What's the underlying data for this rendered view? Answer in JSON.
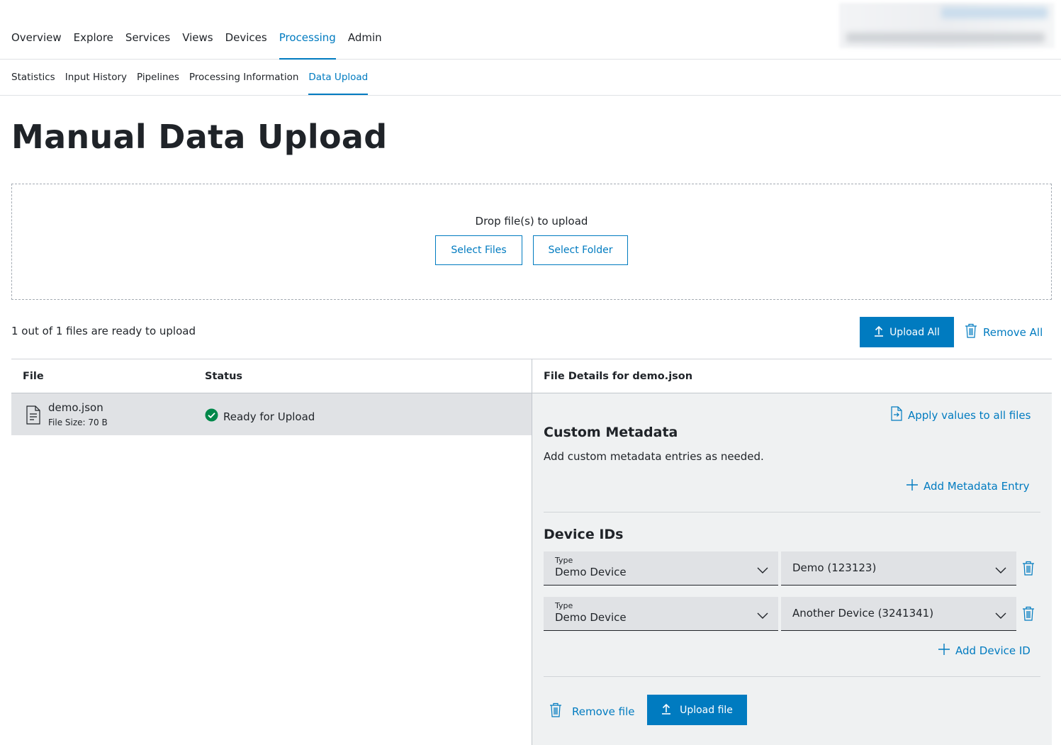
{
  "topnav": {
    "tabs": [
      "Overview",
      "Explore",
      "Services",
      "Views",
      "Devices",
      "Processing",
      "Admin"
    ],
    "active": "Processing"
  },
  "subnav": {
    "tabs": [
      "Statistics",
      "Input History",
      "Pipelines",
      "Processing Information",
      "Data Upload"
    ],
    "active": "Data Upload"
  },
  "page_title": "Manual Data Upload",
  "dropzone": {
    "text": "Drop file(s) to upload",
    "select_files": "Select Files",
    "select_folder": "Select Folder"
  },
  "summary": {
    "ready_text": "1 out of 1 files are ready to upload",
    "upload_all": "Upload All",
    "remove_all": "Remove All"
  },
  "table": {
    "col_file": "File",
    "col_status": "Status",
    "rows": [
      {
        "name": "demo.json",
        "size": "File Size: 70 B",
        "status": "Ready for Upload"
      }
    ]
  },
  "details": {
    "title": "File Details for demo.json",
    "apply_all": "Apply values to all files",
    "custom_metadata_title": "Custom Metadata",
    "custom_metadata_hint": "Add custom metadata entries as needed.",
    "add_metadata": "Add Metadata Entry",
    "device_ids_title": "Device IDs",
    "device_rows": [
      {
        "type_label": "Type",
        "type_value": "Demo Device",
        "device": "Demo (123123)"
      },
      {
        "type_label": "Type",
        "type_value": "Demo Device",
        "device": "Another Device (3241341)"
      }
    ],
    "add_device": "Add Device ID",
    "remove_file": "Remove file",
    "upload_file": "Upload file"
  },
  "colors": {
    "accent": "#007bc0",
    "success": "#00884a",
    "row_bg": "#e0e2e5",
    "panel_bg": "#eff1f2"
  },
  "icons": [
    "upload-icon",
    "trash-icon",
    "file-icon",
    "check-circle-icon",
    "apply-file-icon",
    "plus-icon",
    "chevron-down-icon"
  ]
}
